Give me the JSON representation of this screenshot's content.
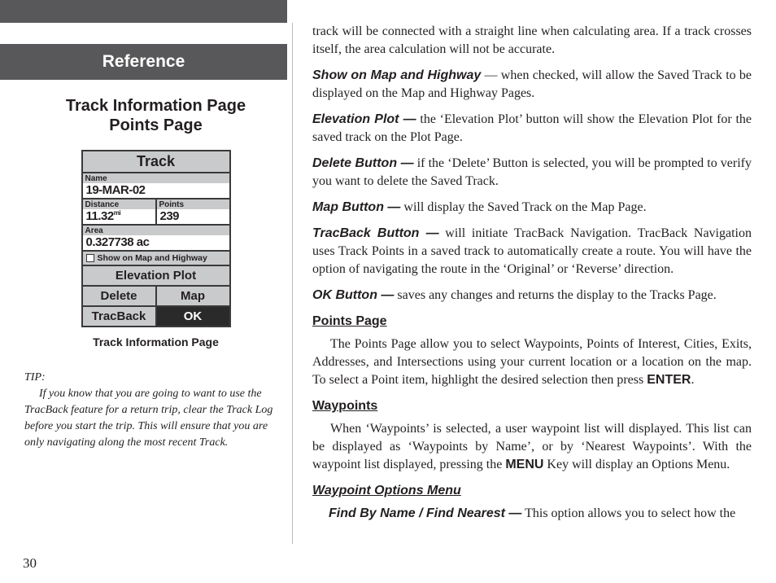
{
  "header": {
    "section": "Reference"
  },
  "left": {
    "subtitle_l1": "Track Information Page",
    "subtitle_l2": "Points Page",
    "caption": "Track Information Page",
    "tip_head": "TIP:",
    "tip_body": "If you know that you are going to want to use the TracBack feature for a return trip, clear the Track Log before you start the trip.  This will ensure that you are only navigating along the most recent Track."
  },
  "device": {
    "title": "Track",
    "name_label": "Name",
    "name_value": "19-MAR-02",
    "distance_label": "Distance",
    "distance_value": "11.32",
    "distance_unit": "mi",
    "points_label": "Points",
    "points_value": "239",
    "area_label": "Area",
    "area_value": "0.327738 ac",
    "checkbox_label": "Show on Map and Highway",
    "elev_btn": "Elevation Plot",
    "delete_btn": "Delete",
    "map_btn": "Map",
    "tracback_btn": "TracBack",
    "ok_btn": "OK"
  },
  "right": {
    "p0": "track will be connected with a straight line when calculating area.  If a track crosses itself, the area calculation will not be accurate.",
    "show_term": "Show on Map and Highway",
    "show_desc": " — when checked, will allow the Saved Track to be displayed on the Map and Highway Pages.",
    "elev_term": "Elevation Plot —",
    "elev_desc": " the ‘Elevation Plot’ button will show the Elevation Plot for the saved track on the Plot Page.",
    "del_term": "Delete Button —",
    "del_desc": " if the ‘Delete’ Button is selected, you will be prompted to verify you want to delete the Saved Track.",
    "map_term": "Map Button —",
    "map_desc": " will display the Saved Track on the Map Page.",
    "trac_term": "TracBack Button —",
    "trac_desc": " will initiate TracBack Navigation.  TracBack Navigation uses Track Points in a saved track to automatically create a route.  You will have the option of navigating the route in the ‘Original’ or ‘Reverse’ direction.",
    "ok_term": "OK Button —",
    "ok_desc": " saves any changes and returns the display to the Tracks Page.",
    "points_h": "Points Page",
    "points_p": "The Points Page allow you to select Waypoints, Points of Interest, Cities, Exits, Addresses, and Intersections using your current location or a location on the map.  To select a Point item, highlight the desired selection then press ",
    "enter": "ENTER",
    "period": ".",
    "waypoints_h": "Waypoints",
    "waypoints_p_a": "When ‘Waypoints’ is selected, a user waypoint list will displayed.  This list can be displayed as ‘Waypoints by Name’, or by ‘Nearest Waypoints’.  With the waypoint list displayed, pressing the ",
    "menu": "MENU",
    "waypoints_p_b": " Key will display an Options Menu.",
    "wom_h": "Waypoint Options Menu",
    "fbn_term": "Find By Name / Find Nearest —",
    "fbn_desc": " This option allows you to select how the"
  },
  "page_number": "30"
}
